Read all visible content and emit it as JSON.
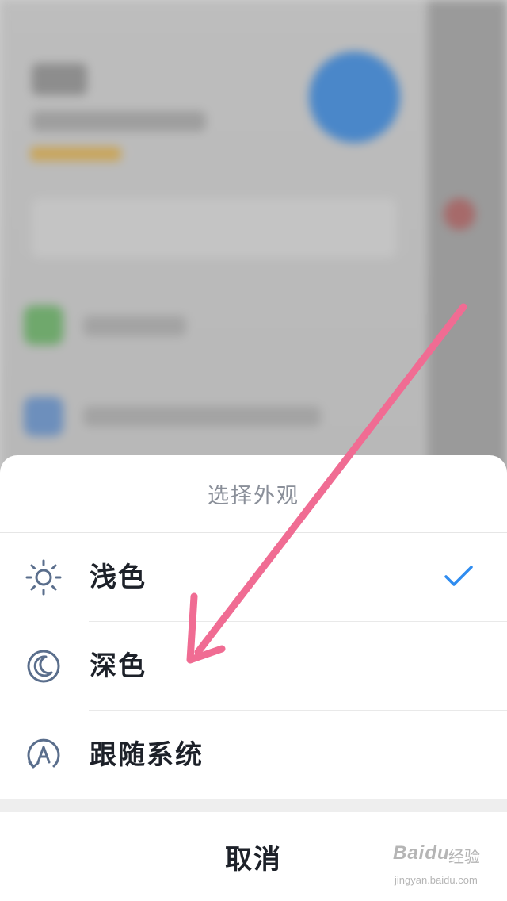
{
  "sheet": {
    "title": "选择外观",
    "options": [
      {
        "label": "浅色",
        "icon": "sun-icon",
        "selected": true
      },
      {
        "label": "深色",
        "icon": "moon-icon",
        "selected": false
      },
      {
        "label": "跟随系统",
        "icon": "auto-theme-icon",
        "selected": false
      }
    ],
    "cancel_label": "取消"
  },
  "colors": {
    "accent": "#2f8cf0",
    "icon": "#5a6e8c",
    "arrow": "#f06c93"
  },
  "watermark": {
    "brand": "Baidu",
    "suffix": "经验",
    "url": "jingyan.baidu.com"
  }
}
